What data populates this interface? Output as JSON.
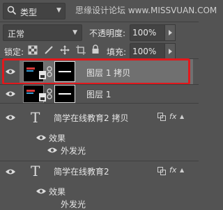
{
  "filter": {
    "kind_label": "类型",
    "watermark": "思缘设计论坛  www.MISSVUAN.COM"
  },
  "blend": {
    "mode": "正常",
    "opacity_label": "不透明度:",
    "opacity_value": "100%"
  },
  "lock": {
    "label": "锁定:",
    "fill_label": "填充:",
    "fill_value": "100%"
  },
  "layers": [
    {
      "name": "图层 1 拷贝",
      "selected": true
    },
    {
      "name": "图层 1",
      "selected": false
    },
    {
      "name": "简学在线教育2 拷贝",
      "effects_label": "效果",
      "effect": "外发光"
    },
    {
      "name": "简学在线教育2",
      "effects_label": "效果",
      "effect": "外发光"
    }
  ],
  "icons": [
    "eye-icon",
    "link-icon",
    "text-layer-icon",
    "fx-icon",
    "search-icon"
  ],
  "colors": {
    "panel": "#535353",
    "selected": "#707070",
    "highlight": "#e2181c"
  }
}
